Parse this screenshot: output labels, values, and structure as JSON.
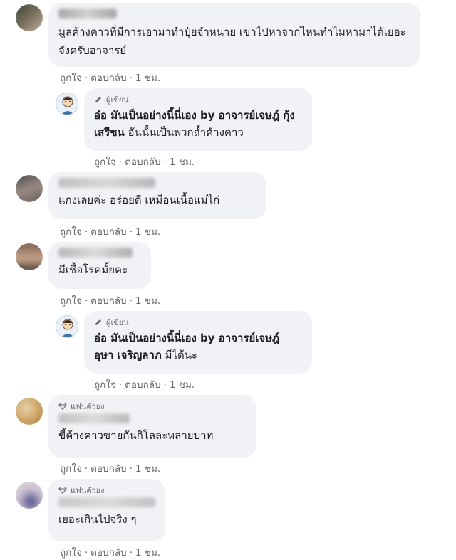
{
  "comments": [
    {
      "avatar_colors": [
        "#2d3b2c",
        "#7a6f5c",
        "#c9b9a3"
      ],
      "text": "มูลค้างคาวที่มีการเอามาทำปุ๋ยจำหน่าย เขาไปหาจากไหนทำไมหามาได้เยอะจังครับอาจารย์",
      "actions": {
        "like": "ถูกใจ",
        "reply": "ตอบกลับ",
        "time": "1 ชม."
      }
    },
    {
      "badge": "ผู้เขียน",
      "text_bold": "อ๋อ มันเป็นอย่างนี้นี่เอง by อาจารย์เจษฎ์ กุ้ง เสรีชน",
      "text": "อันนั้นเป็นพวกถ้ำค้างคาว",
      "actions": {
        "like": "ถูกใจ",
        "reply": "ตอบกลับ",
        "time": "1 ชม."
      }
    },
    {
      "avatar_colors": [
        "#3b3a3a",
        "#9a8c86",
        "#5c4d48"
      ],
      "text": "แกงเลยค่ะ อร่อยดี เหมือนเนื้อแม่ไก่",
      "actions": {
        "like": "ถูกใจ",
        "reply": "ตอบกลับ",
        "time": "1 ชม."
      }
    },
    {
      "avatar_colors": [
        "#6e5446",
        "#c7a58c",
        "#3a2c26"
      ],
      "text": "มีเชื้อโรคมั้ยคะ",
      "actions": {
        "like": "ถูกใจ",
        "reply": "ตอบกลับ",
        "time": "1 ชม."
      }
    },
    {
      "badge": "ผู้เขียน",
      "text_bold": "อ๋อ มันเป็นอย่างนี้นี่เอง by อาจารย์เจษฎ์ อุษา เจริญลาภ",
      "text": "มีได้นะ",
      "actions": {
        "like": "ถูกใจ",
        "reply": "ตอบกลับ",
        "time": "1 ชม."
      }
    },
    {
      "avatar_colors": [
        "#c79b5a",
        "#e9d7ad",
        "#8a6a3a"
      ],
      "badge": "แฟนตัวยง",
      "text": "ขี้ค้างคาวขายกันกิโลละหลายบาท",
      "actions": {
        "like": "ถูกใจ",
        "reply": "ตอบกลับ",
        "time": "1 ชม."
      }
    },
    {
      "avatar_colors": [
        "#cfc3cf",
        "#4a4b8e",
        "#e6d7dd"
      ],
      "badge": "แฟนตัวยง",
      "text": "เยอะเกินไปจริง ๆ",
      "actions": {
        "like": "ถูกใจ",
        "reply": "ตอบกลับ",
        "time": "1 ชม."
      }
    }
  ]
}
